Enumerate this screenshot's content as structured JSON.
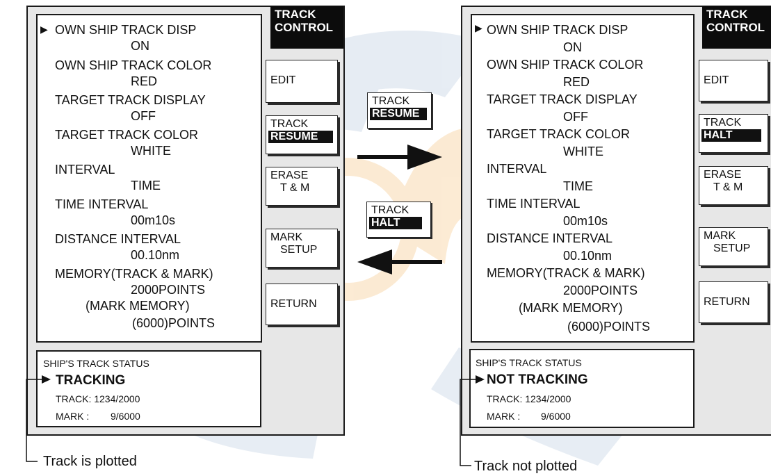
{
  "menu": {
    "title_line1": "TRACK",
    "title_line2": "CONTROL",
    "cursor": "▶",
    "items": [
      {
        "label": "OWN SHIP TRACK DISP",
        "value": "ON"
      },
      {
        "label": "OWN SHIP TRACK COLOR",
        "value": "RED"
      },
      {
        "label": "TARGET TRACK DISPLAY",
        "value": "OFF"
      },
      {
        "label": "TARGET TRACK COLOR",
        "value": "WHITE"
      },
      {
        "label": "INTERVAL",
        "value": "TIME"
      },
      {
        "label": "TIME INTERVAL",
        "value": "00m10s"
      },
      {
        "label": "DISTANCE INTERVAL",
        "value": "00.10nm"
      },
      {
        "label": "MEMORY(TRACK & MARK)",
        "value": "2000POINTS"
      },
      {
        "label": "(MARK MEMORY)",
        "value": "(6000)POINTS"
      }
    ]
  },
  "softkeys": {
    "edit": "EDIT",
    "track": "TRACK",
    "resume": "RESUME",
    "halt": "HALT",
    "erase_line1": "ERASE",
    "erase_line2": "T & M",
    "mark_line1": "MARK",
    "mark_line2": "SETUP",
    "return": "RETURN"
  },
  "status": {
    "heading": "SHIP'S TRACK STATUS",
    "left_state": "TRACKING",
    "right_state": "NOT TRACKING",
    "track_count": "TRACK: 1234/2000",
    "mark_label": "MARK :",
    "mark_count": "9/6000"
  },
  "annotations": {
    "left": "Track is plotted",
    "right": "Track not plotted"
  },
  "colors": {
    "panel_bg": "#e7e7e7",
    "title_bg": "#0c0c0c",
    "watermark_orange": "#f9d7a9",
    "watermark_blue": "#cfdbe9"
  }
}
